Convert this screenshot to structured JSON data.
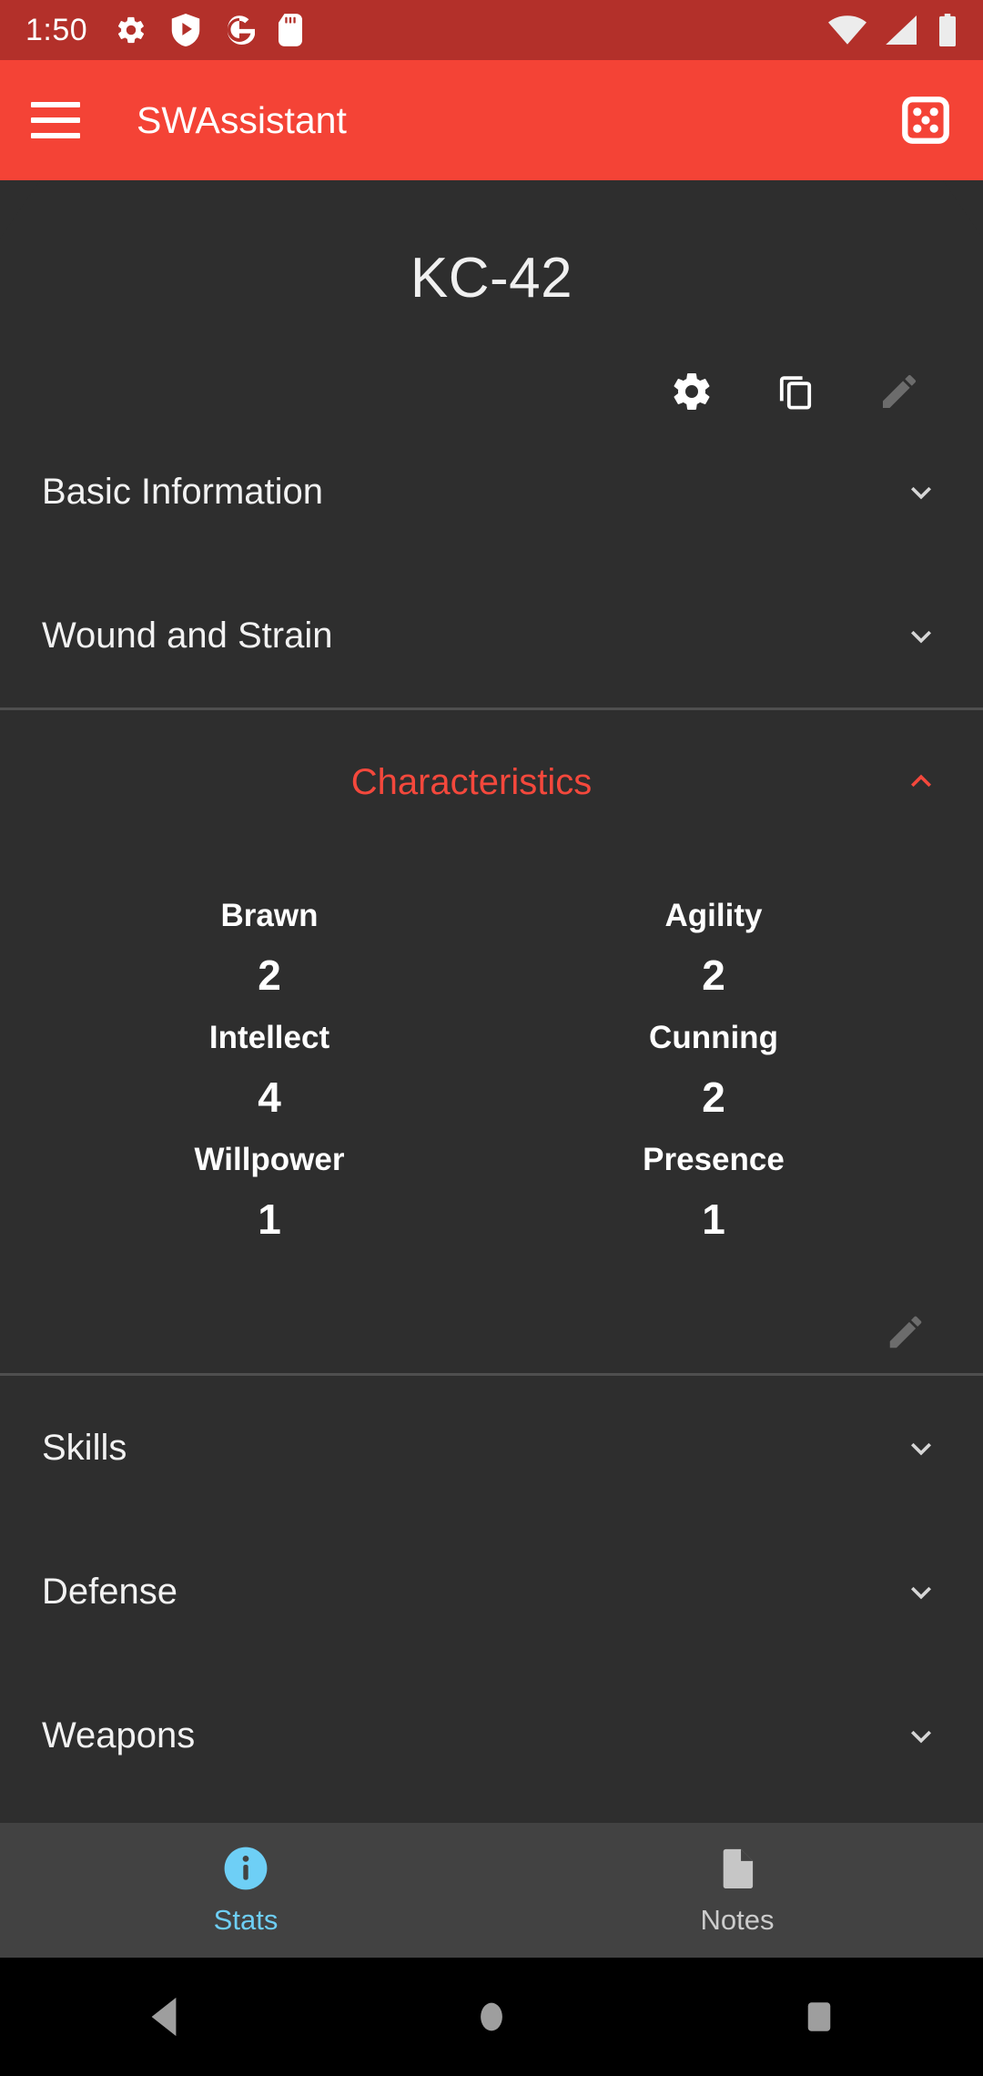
{
  "status_bar": {
    "clock": "1:50",
    "left_icons": [
      "settings-gear-icon",
      "play-protect-shield-icon",
      "google-g-icon",
      "sd-card-icon"
    ],
    "right_icons": [
      "wifi-icon",
      "cell-signal-icon",
      "battery-icon"
    ],
    "background_color": "#b3302a"
  },
  "app_bar": {
    "title": "SWAssistant",
    "menu_icon": "hamburger-menu-icon",
    "dice_icon": "dice-roller-icon",
    "background_color": "#f44336"
  },
  "character": {
    "name": "KC-42",
    "actions": [
      {
        "name": "settings-icon",
        "enabled": true
      },
      {
        "name": "duplicate-icon",
        "enabled": true
      },
      {
        "name": "edit-pencil-icon",
        "enabled": false
      }
    ]
  },
  "sections": [
    {
      "label": "Basic Information",
      "expanded": false,
      "chevron": "chevron-down-icon"
    },
    {
      "label": "Wound and Strain",
      "expanded": false,
      "chevron": "chevron-down-icon"
    },
    {
      "label": "Characteristics",
      "expanded": true,
      "chevron": "chevron-up-icon",
      "accent_color": "#f4483c"
    },
    {
      "label": "Skills",
      "expanded": false,
      "chevron": "chevron-down-icon"
    },
    {
      "label": "Defense",
      "expanded": false,
      "chevron": "chevron-down-icon"
    },
    {
      "label": "Weapons",
      "expanded": false,
      "chevron": "chevron-down-icon"
    }
  ],
  "characteristics": {
    "edit_icon": "edit-pencil-icon",
    "rows": [
      {
        "left_name": "Brawn",
        "left_value": "2",
        "right_name": "Agility",
        "right_value": "2"
      },
      {
        "left_name": "Intellect",
        "left_value": "4",
        "right_name": "Cunning",
        "right_value": "2"
      },
      {
        "left_name": "Willpower",
        "left_value": "1",
        "right_name": "Presence",
        "right_value": "1"
      }
    ]
  },
  "bottom_nav": {
    "items": [
      {
        "label": "Stats",
        "icon": "info-circle-icon",
        "active": true,
        "color": "#6ecff6"
      },
      {
        "label": "Notes",
        "icon": "document-icon",
        "active": false,
        "color": "#cccccc"
      }
    ]
  },
  "system_nav": {
    "back": "back-triangle-icon",
    "home": "home-circle-icon",
    "recents": "recents-square-icon"
  },
  "theme": {
    "background": "#2e2e2e",
    "divider": "#4f4f4f",
    "accent": "#f4483c",
    "nav_background": "#424242"
  }
}
